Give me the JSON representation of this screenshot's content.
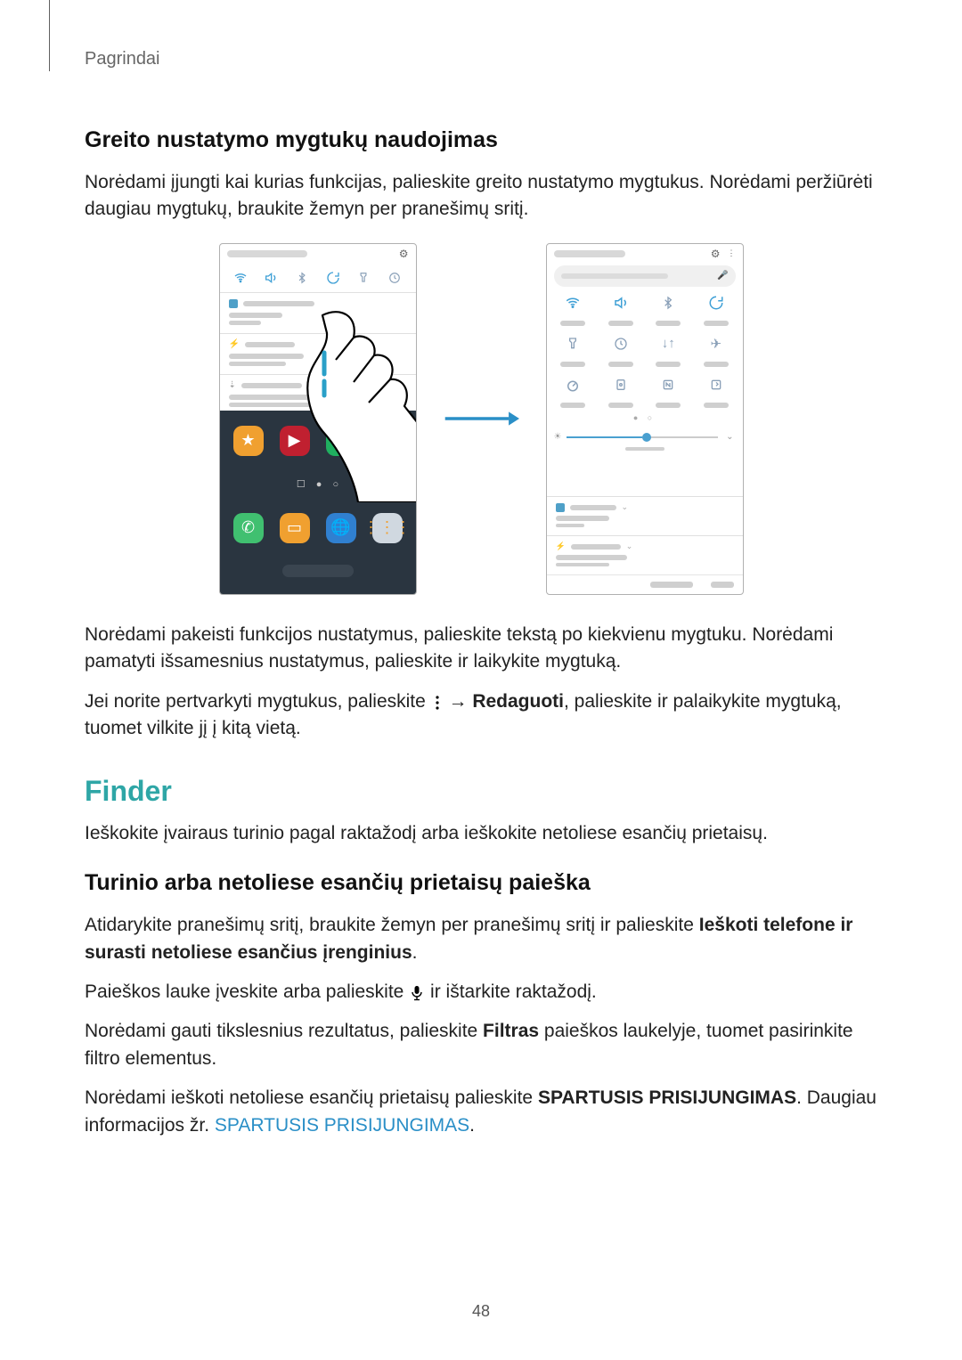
{
  "header": {
    "section": "Pagrindai"
  },
  "h3a": "Greito nustatymo mygtukų naudojimas",
  "p1": "Norėdami įjungti kai kurias funkcijas, palieskite greito nustatymo mygtukus. Norėdami peržiūrėti daugiau mygtukų, braukite žemyn per pranešimų sritį.",
  "p2": "Norėdami pakeisti funkcijos nustatymus, palieskite tekstą po kiekvienu mygtuku. Norėdami pamatyti išsamesnius nustatymus, palieskite ir laikykite mygtuką.",
  "p3_a": "Jei norite pertvarkyti mygtukus, palieskite ",
  "p3_b": " → ",
  "p3_bold": "Redaguoti",
  "p3_c": ", palieskite ir palaikykite mygtuką, tuomet vilkite jį į kitą vietą.",
  "finder": "Finder",
  "p4": "Ieškokite įvairaus turinio pagal raktažodį arba ieškokite netoliese esančių prietaisų.",
  "h3b": "Turinio arba netoliese esančių prietaisų paieška",
  "p5_a": "Atidarykite pranešimų sritį, braukite žemyn per pranešimų sritį ir palieskite ",
  "p5_bold": "Ieškoti telefone ir surasti netoliese esančius įrenginius",
  "p5_b": ".",
  "p6_a": "Paieškos lauke įveskite arba palieskite ",
  "p6_b": " ir ištarkite raktažodį.",
  "p7_a": "Norėdami gauti tikslesnius rezultatus, palieskite ",
  "p7_bold": "Filtras",
  "p7_b": " paieškos laukelyje, tuomet pasirinkite filtro elementus.",
  "p8_a": "Norėdami ieškoti netoliese esančių prietaisų palieskite ",
  "p8_bold": "SPARTUSIS PRISIJUNGIMAS",
  "p8_b": ". Daugiau informacijos žr. ",
  "p8_link": "SPARTUSIS PRISIJUNGIMAS",
  "p8_c": ".",
  "page_number": "48"
}
